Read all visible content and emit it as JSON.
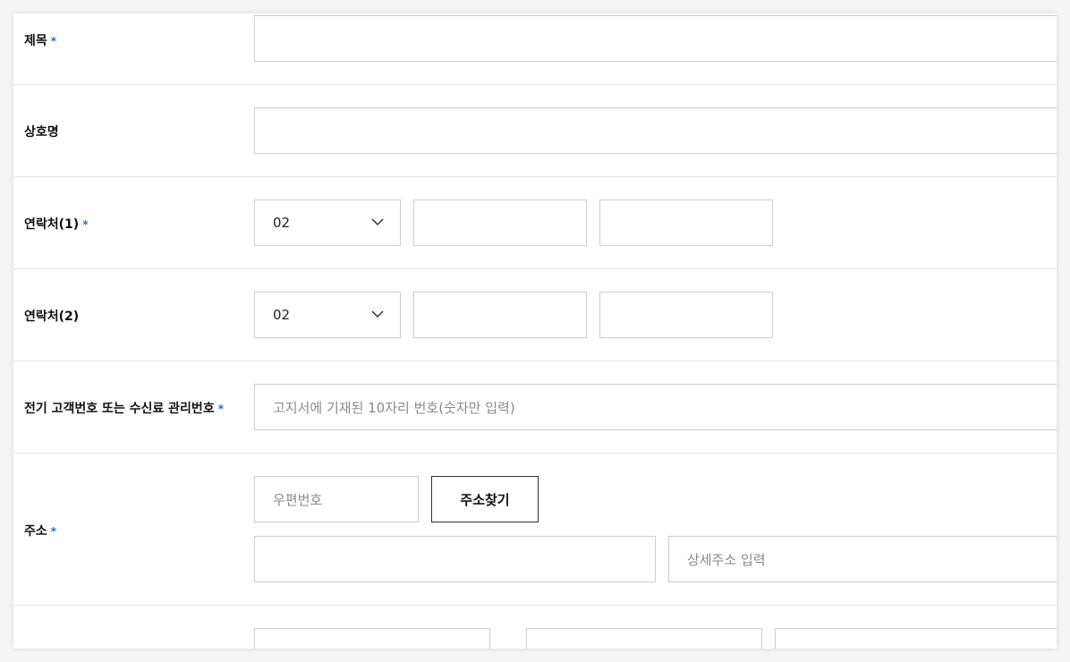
{
  "form": {
    "title": {
      "label": "제목",
      "required_mark": "*",
      "value": ""
    },
    "company": {
      "label": "상호명",
      "value": ""
    },
    "contact1": {
      "label": "연락처(1)",
      "required_mark": "*",
      "area_code": "02",
      "middle": "",
      "last": ""
    },
    "contact2": {
      "label": "연락처(2)",
      "area_code": "02",
      "middle": "",
      "last": ""
    },
    "customer_no": {
      "label": "전기 고객번호 또는 수신료 관리번호",
      "required_mark": "*",
      "placeholder": "고지서에 기재된 10자리 번호(숫자만 입력)"
    },
    "address": {
      "label": "주소",
      "required_mark": "*",
      "postcode_placeholder": "우편번호",
      "search_button": "주소찾기",
      "base_address": "",
      "detail_placeholder": "상세주소 입력"
    }
  },
  "icons": {
    "dropdown": "chevron-down-icon"
  },
  "colors": {
    "required": "#1e6fd9",
    "border": "#cfcfcf",
    "placeholder": "#8a8a8a"
  }
}
